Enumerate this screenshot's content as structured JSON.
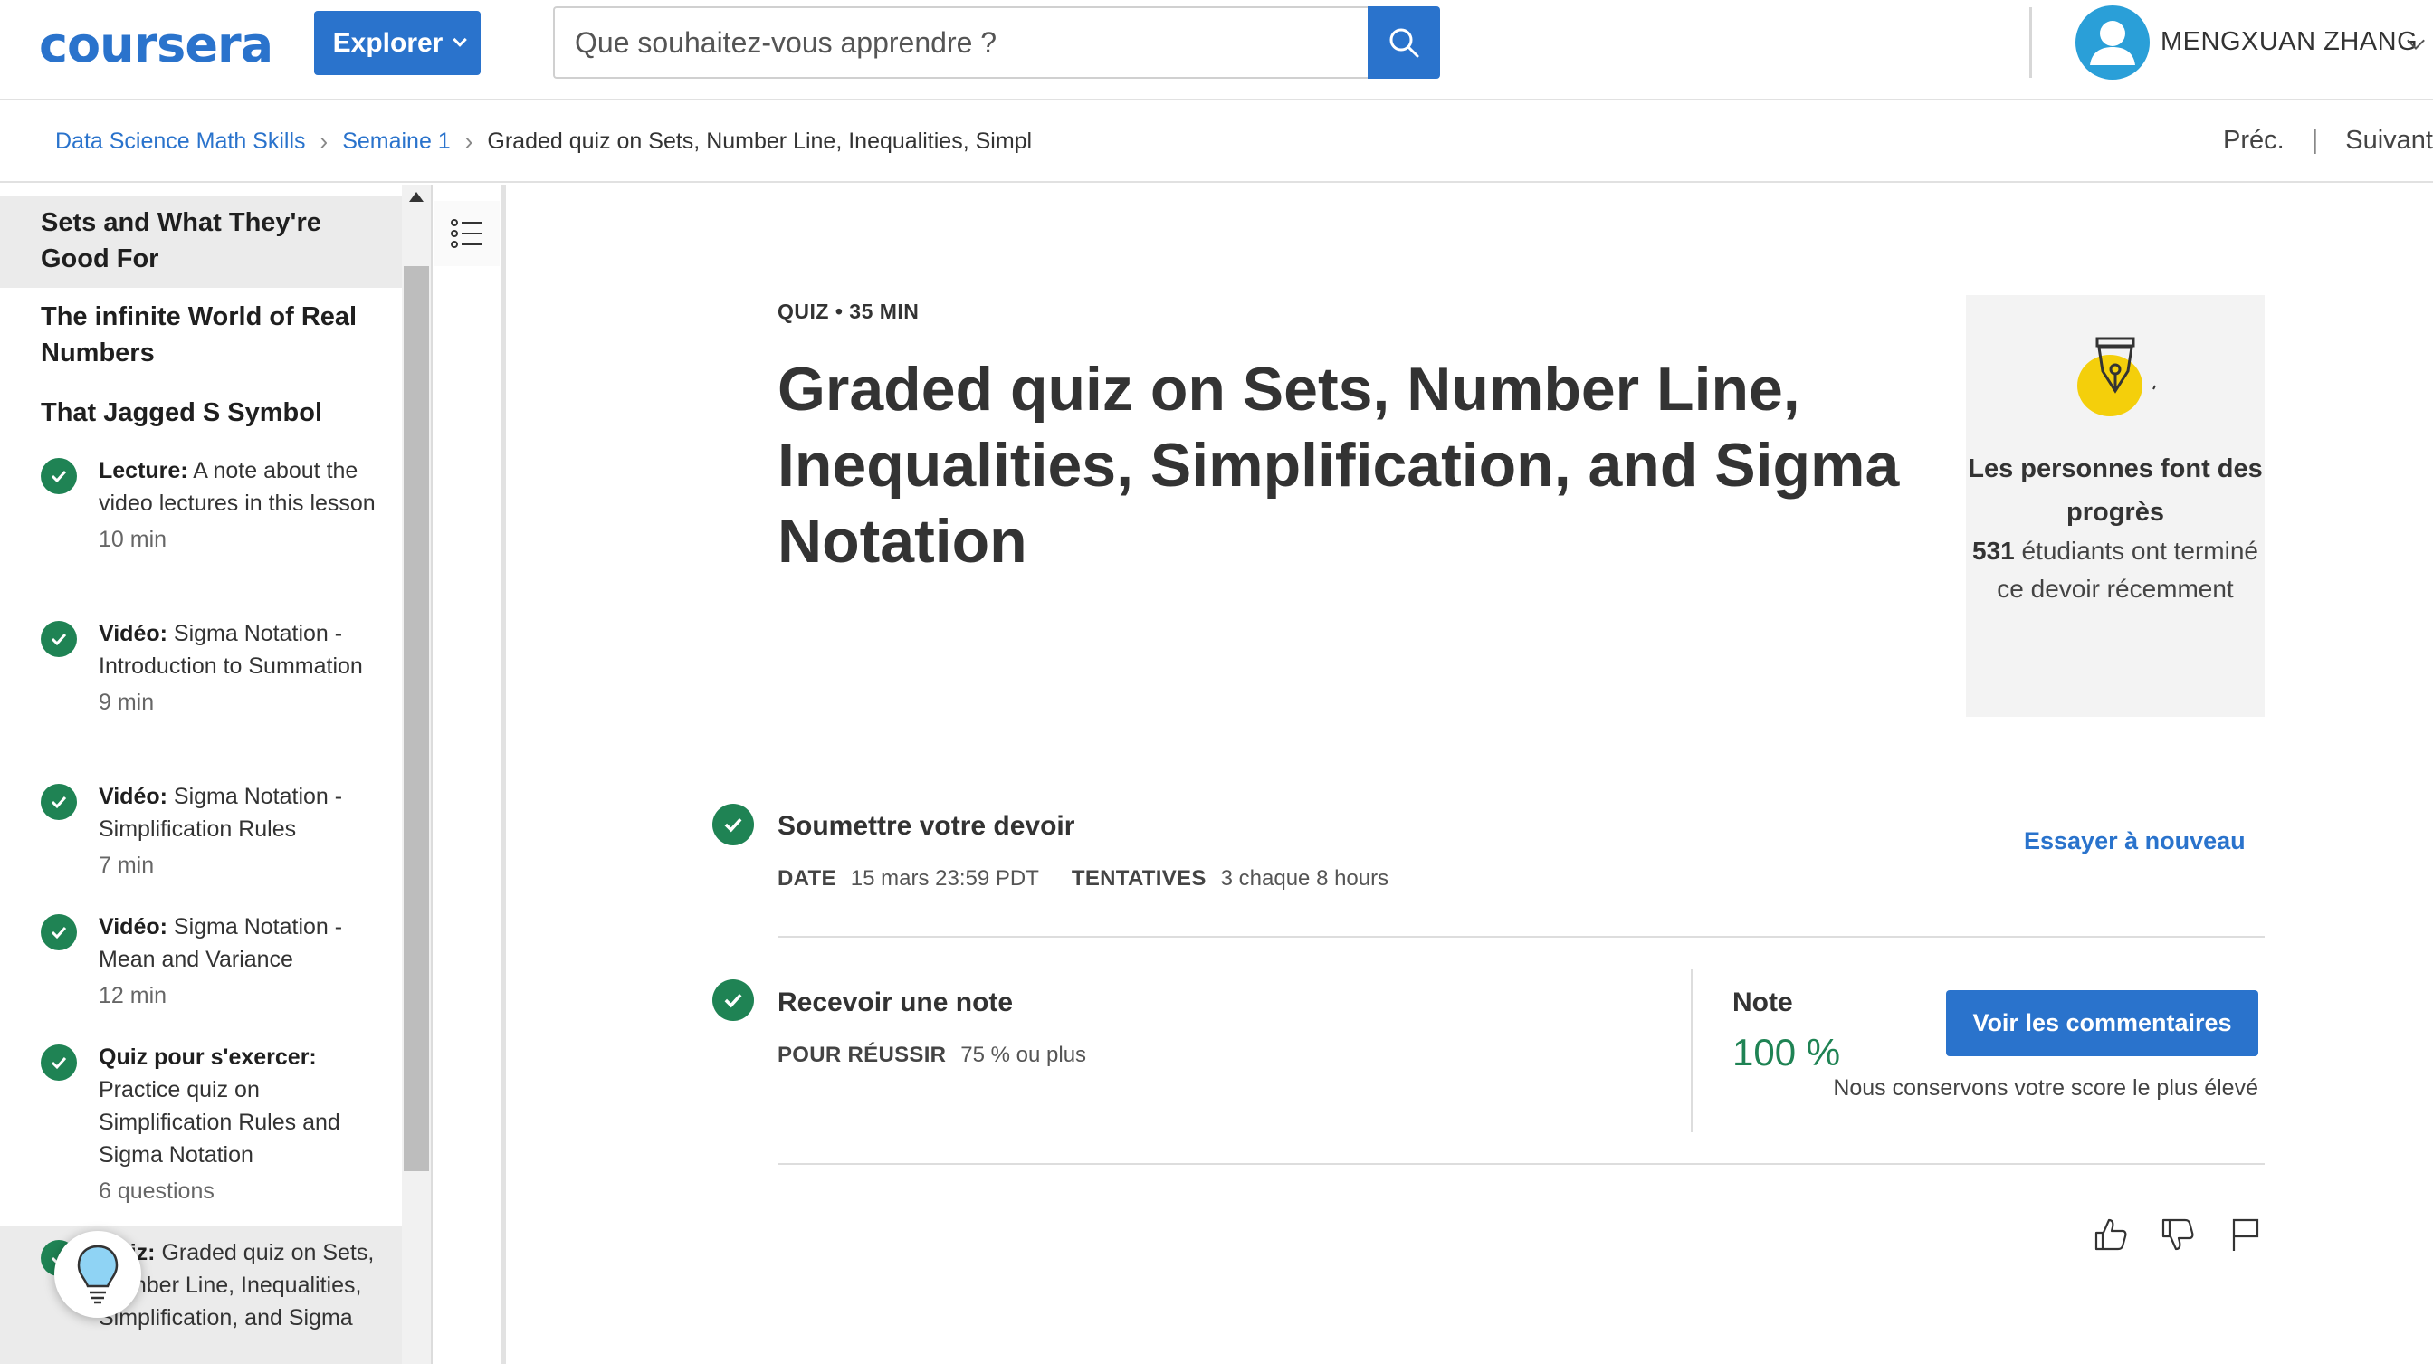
{
  "header": {
    "logo": "coursera",
    "explore_label": "Explorer",
    "search_placeholder": "Que souhaitez-vous apprendre ?",
    "user_name": "MENGXUAN ZHANG"
  },
  "breadcrumb": {
    "items": [
      "Data Science Math Skills",
      "Semaine 1"
    ],
    "current": "Graded quiz on Sets, Number Line, Inequalities, Simpl"
  },
  "nav": {
    "prev": "Préc.",
    "next": "Suivant"
  },
  "sidebar": {
    "sections": [
      "Sets and What They're Good For",
      "The infinite World of Real Numbers",
      "That Jagged S Symbol"
    ],
    "items": [
      {
        "kind": "Lecture:",
        "title": "A note about the video lectures in this lesson",
        "duration": "10  min"
      },
      {
        "kind": "Vidéo:",
        "title": "Sigma Notation - Introduction to Summation",
        "duration": "9  min"
      },
      {
        "kind": "Vidéo:",
        "title": "Sigma Notation - Simplification Rules",
        "duration": "7  min"
      },
      {
        "kind": "Vidéo:",
        "title": "Sigma Notation - Mean and Variance",
        "duration": "12  min"
      },
      {
        "kind": "Quiz pour s'exercer:",
        "title": "Practice quiz on Simplification Rules and Sigma Notation",
        "duration": "6 questions"
      },
      {
        "kind": "Quiz:",
        "title": "Graded quiz on Sets, Number Line, Inequalities, Simplification, and Sigma",
        "duration": ""
      }
    ]
  },
  "main": {
    "meta": "QUIZ • 35  MIN",
    "title": "Graded quiz on Sets, Number Line, Inequalities, Simplification, and Sigma Notation",
    "progress_card": {
      "heading": "Les personnes font des progrès",
      "count": "531",
      "text": "étudiants ont terminé ce devoir récemment"
    },
    "submit": {
      "title": "Soumettre votre devoir",
      "date_label": "DATE",
      "date_value": "15 mars 23:59 PDT",
      "attempts_label": "TENTATIVES",
      "attempts_value": "3 chaque 8  hours",
      "retry": "Essayer à nouveau"
    },
    "grade": {
      "title": "Recevoir une note",
      "pass_label": "POUR RÉUSSIR",
      "pass_value": "75 % ou plus",
      "note_label": "Note",
      "note_value": "100 %",
      "feedback_button": "Voir les commentaires",
      "keep_note": "Nous conservons votre score le plus élevé"
    }
  },
  "colors": {
    "brand": "#2a73cc",
    "success": "#1f8354"
  }
}
